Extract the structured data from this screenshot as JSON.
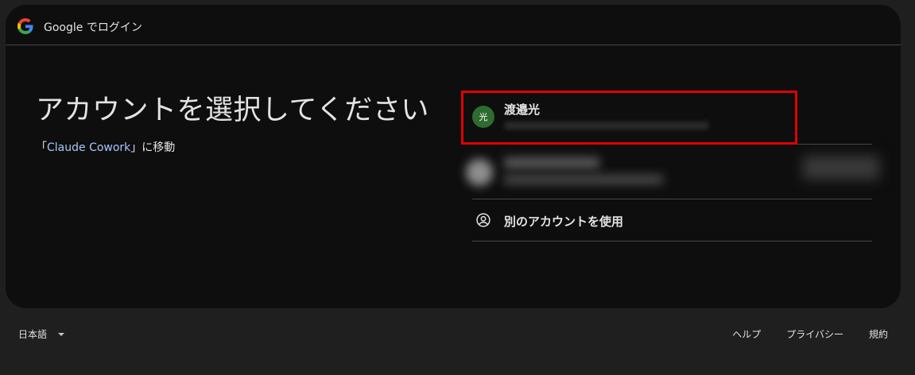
{
  "header": {
    "logo_icon": "google-g-logo-icon",
    "title": "Google でログイン"
  },
  "main": {
    "title": "アカウントを選択してください",
    "subtitle_prefix": "「",
    "subtitle_link": "Claude Cowork",
    "subtitle_suffix": "」に移動"
  },
  "accounts": [
    {
      "avatar_letter": "光",
      "avatar_color": "#2e6b2e",
      "name": "渡邉光",
      "highlight_color": "#e00000"
    }
  ],
  "use_other": {
    "icon": "account-circle-icon",
    "label": "別のアカウントを使用"
  },
  "footer": {
    "language": "日本語",
    "links": [
      "ヘルプ",
      "プライバシー",
      "規約"
    ]
  }
}
